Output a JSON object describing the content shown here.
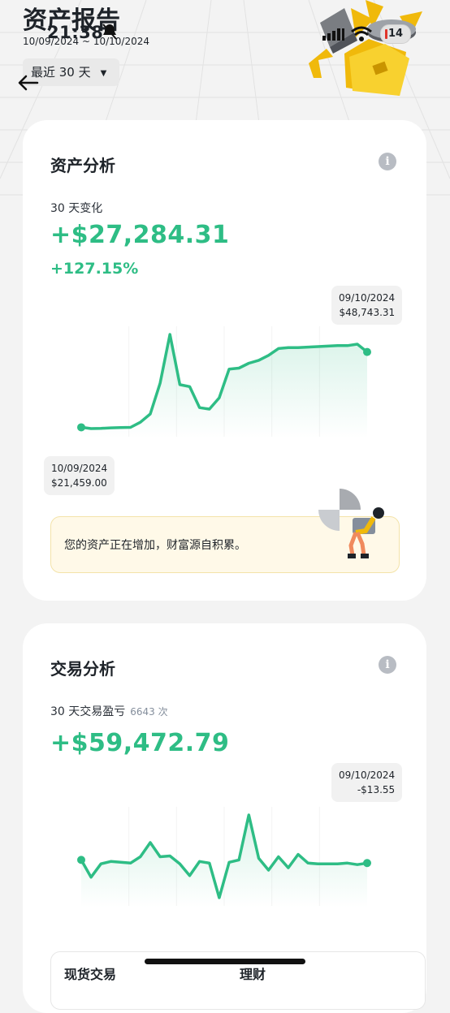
{
  "status_bar": {
    "time": "21:38",
    "battery": "14"
  },
  "header": {
    "title": "资产报告",
    "date_range": "10/09/2024 ~ 10/10/2024",
    "period_select": "最近 30 天"
  },
  "asset_card": {
    "title": "资产分析",
    "change_label": "30 天变化",
    "change_value": "+$27,284.31",
    "change_pct": "+127.15%",
    "tip_end": {
      "date": "09/10/2024",
      "value": "$48,743.31"
    },
    "tip_start": {
      "date": "10/09/2024",
      "value": "$21,459.00"
    },
    "banner": "您的资产正在增加，财富源自积累。"
  },
  "trade_card": {
    "title": "交易分析",
    "pnl_label": "30 天交易盈亏",
    "trade_count": "6643 次",
    "pnl_value": "+$59,472.79",
    "tip_end": {
      "date": "09/10/2024",
      "value": "-$13.55"
    },
    "bottom_left_label": "现货交易",
    "bottom_right_label": "理财"
  },
  "colors": {
    "positive": "#2ebd85",
    "accent": "#f0b90b",
    "card": "#ffffff",
    "page": "#f3f3f3"
  },
  "chart_data": [
    {
      "type": "line",
      "title": "资产分析",
      "series": [
        {
          "values": [
            21459,
            21200,
            21250,
            21350,
            21400,
            21450,
            22500,
            24200,
            30500,
            40500,
            30200,
            29800,
            25500,
            25200,
            27500,
            33400,
            33600,
            34600,
            35200,
            36200,
            37600,
            37800,
            37800,
            37900,
            38000,
            38100,
            38200,
            38200,
            38500,
            36900
          ]
        }
      ],
      "annotations": [
        {
          "label": "10/09/2024",
          "value": "$21,459.00",
          "position": "bottom-left"
        },
        {
          "label": "09/10/2024",
          "value": "$48,743.31",
          "position": "top-right"
        }
      ]
    },
    {
      "type": "line",
      "title": "交易分析",
      "series": [
        {
          "values": [
            800,
            -1400,
            300,
            600,
            500,
            400,
            1200,
            3000,
            1200,
            1300,
            300,
            -1200,
            600,
            400,
            -4000,
            500,
            800,
            6500,
            1000,
            -500,
            1200,
            -200,
            1500,
            400,
            300,
            300,
            300,
            400,
            200,
            400
          ]
        }
      ],
      "annotations": [
        {
          "label": "09/10/2024",
          "value": "-$13.55",
          "position": "top-right"
        }
      ]
    }
  ]
}
